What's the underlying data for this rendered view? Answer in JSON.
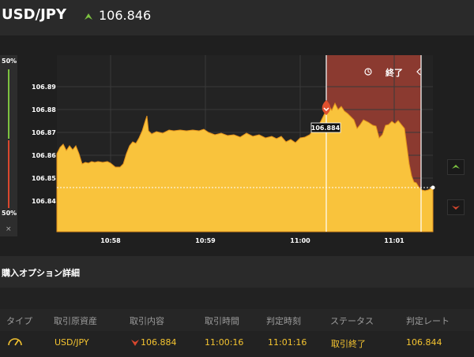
{
  "header": {
    "pair": "USD/JPY",
    "rate": "106.846"
  },
  "gauge": {
    "top_pct": "50%",
    "bottom_pct": "50%",
    "close": "×"
  },
  "chart_data": {
    "type": "area",
    "y_ticks": [
      "106.89",
      "106.88",
      "106.87",
      "106.86",
      "106.85",
      "106.84"
    ],
    "x_ticks": [
      "10:58",
      "10:59",
      "11:00",
      "11:01"
    ],
    "entry_label": "106.884",
    "end_label": "終了",
    "fill_color": "#f9c33c",
    "expiry_region_color": "#8b3a30"
  },
  "section": {
    "title": "購入オプション詳細"
  },
  "table": {
    "headers": [
      "タイプ",
      "取引原資産",
      "取引内容",
      "取引時間",
      "判定時刻",
      "ステータス",
      "判定レート"
    ],
    "row": {
      "asset": "USD/JPY",
      "content": "106.884",
      "time": "11:00:16",
      "judge_time": "11:01:16",
      "status": "取引終了",
      "rate": "106.844"
    }
  }
}
